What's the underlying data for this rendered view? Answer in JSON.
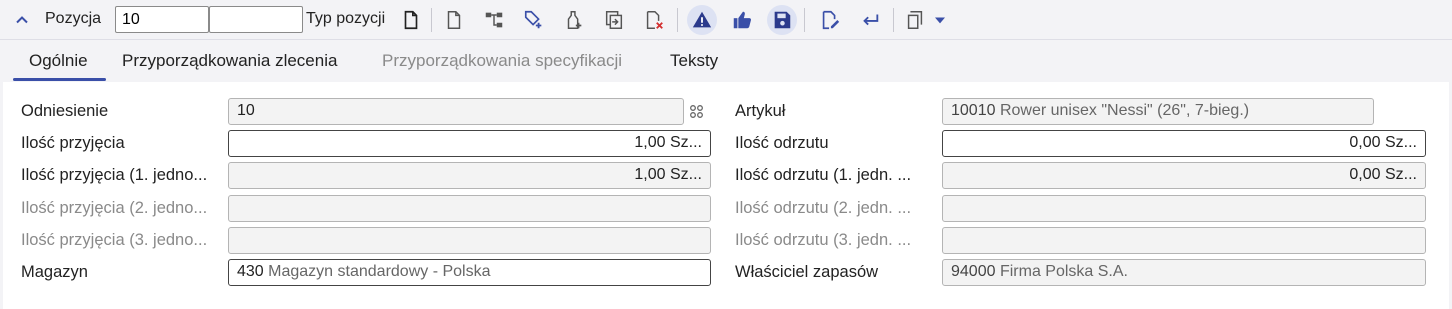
{
  "toolbar": {
    "pozycja_label": "Pozycja",
    "pozycja_value": "10",
    "pozycja_value2": "",
    "typ_label": "Typ pozycji"
  },
  "tabs": [
    {
      "label": "Ogólnie",
      "active": true
    },
    {
      "label": "Przyporządkowania zlecenia"
    },
    {
      "label": "Przyporządkowania specyfikacji",
      "disabled": true
    },
    {
      "label": "Teksty"
    }
  ],
  "form": {
    "odniesienie": {
      "label": "Odniesienie",
      "value": "10"
    },
    "ilosc_przyjecia": {
      "label": "Ilość przyjęcia",
      "value": "1,00 Sz..."
    },
    "ilosc_przyjecia_1": {
      "label": "Ilość przyjęcia (1. jedno...",
      "value": "1,00 Sz..."
    },
    "ilosc_przyjecia_2": {
      "label": "Ilość przyjęcia (2. jedno...",
      "value": ""
    },
    "ilosc_przyjecia_3": {
      "label": "Ilość przyjęcia (3. jedno...",
      "value": ""
    },
    "magazyn": {
      "label": "Magazyn",
      "code": "430",
      "desc": "Magazyn standardowy - Polska"
    },
    "artykul": {
      "label": "Artykuł",
      "code": "10010",
      "desc": "Rower unisex \"Nessi\" (26\", 7-bieg.)"
    },
    "ilosc_odrzutu": {
      "label": "Ilość odrzutu",
      "value": "0,00 Sz..."
    },
    "ilosc_odrzutu_1": {
      "label": "Ilość odrzutu (1. jedn. ...",
      "value": "0,00 Sz..."
    },
    "ilosc_odrzutu_2": {
      "label": "Ilość odrzutu (2. jedn. ...",
      "value": ""
    },
    "ilosc_odrzutu_3": {
      "label": "Ilość odrzutu (3. jedn. ...",
      "value": ""
    },
    "wlasciciel": {
      "label": "Właściciel zapasów",
      "code": "94000",
      "desc": "Firma Polska S.A."
    }
  },
  "colors": {
    "accent": "#3a4fa8",
    "error": "#d32f2f"
  }
}
